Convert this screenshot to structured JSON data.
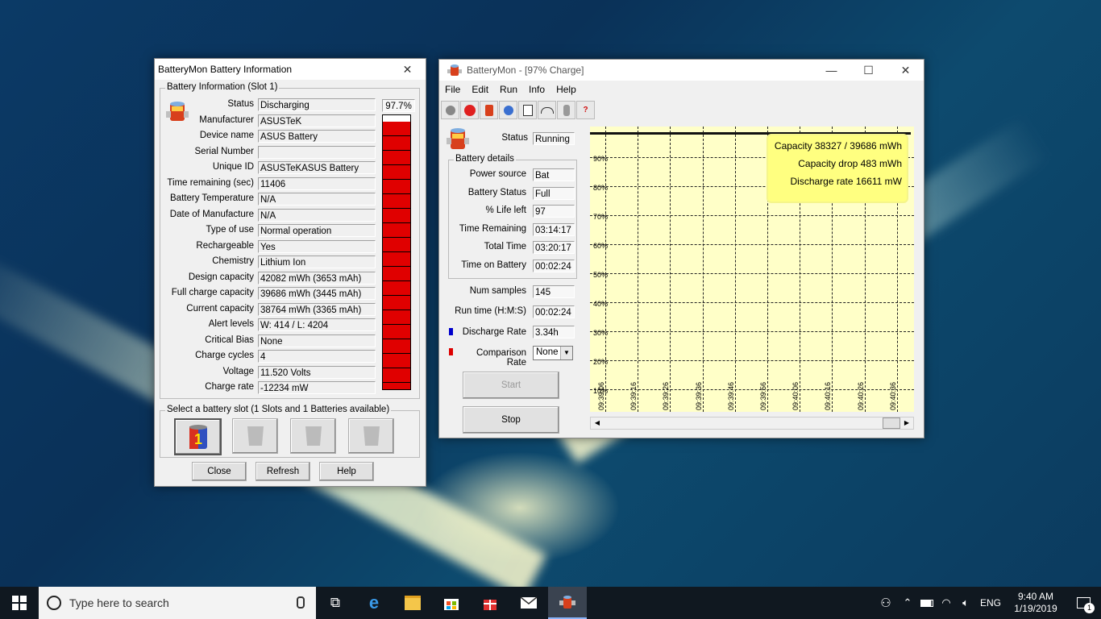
{
  "info_window": {
    "title": "BatteryMon Battery Information",
    "group_label": "Battery Information (Slot 1)",
    "percent": "97.7%",
    "fields": [
      {
        "label": "Status",
        "value": "Discharging"
      },
      {
        "label": "Manufacturer",
        "value": "ASUSTeK"
      },
      {
        "label": "Device name",
        "value": "ASUS Battery"
      },
      {
        "label": "Serial Number",
        "value": ""
      },
      {
        "label": "Unique ID",
        "value": "ASUSTeKASUS Battery"
      },
      {
        "label": "Time remaining (sec)",
        "value": "11406"
      },
      {
        "label": "Battery Temperature",
        "value": "N/A"
      },
      {
        "label": "Date of Manufacture",
        "value": "N/A"
      },
      {
        "label": "Type of use",
        "value": "Normal operation"
      },
      {
        "label": "Rechargeable",
        "value": "Yes"
      },
      {
        "label": "Chemistry",
        "value": "Lithium Ion"
      },
      {
        "label": "Design capacity",
        "value": "42082 mWh (3653 mAh)"
      },
      {
        "label": "Full charge capacity",
        "value": "39686 mWh (3445 mAh)"
      },
      {
        "label": "Current capacity",
        "value": "38764 mWh (3365 mAh)"
      },
      {
        "label": "Alert levels",
        "value": "W: 414 / L: 4204"
      },
      {
        "label": "Critical Bias",
        "value": "None"
      },
      {
        "label": "Charge cycles",
        "value": "4"
      },
      {
        "label": "Voltage",
        "value": "11.520 Volts"
      },
      {
        "label": "Charge rate",
        "value": "-12234 mW"
      }
    ],
    "slot_group_label": "Select a battery slot (1 Slots and 1 Batteries available)",
    "slot_one_label": "1",
    "buttons": {
      "close": "Close",
      "refresh": "Refresh",
      "help": "Help"
    }
  },
  "main_window": {
    "title": "BatteryMon - [97% Charge]",
    "menu": [
      "File",
      "Edit",
      "Run",
      "Info",
      "Help"
    ],
    "status_label": "Status",
    "status_value": "Running",
    "details_group": "Battery details",
    "details": [
      {
        "label": "Power source",
        "value": "Bat"
      },
      {
        "label": "Battery Status",
        "value": "Full"
      },
      {
        "label": "% Life left",
        "value": "97"
      },
      {
        "label": "Time Remaining",
        "value": "03:14:17"
      },
      {
        "label": "Total Time",
        "value": "03:20:17"
      },
      {
        "label": "Time on Battery",
        "value": "00:02:24"
      }
    ],
    "num_samples_label": "Num samples",
    "num_samples": "145",
    "run_time_label": "Run time (H:M:S)",
    "run_time": "00:02:24",
    "discharge_label": "Discharge Rate",
    "discharge_value": "3.34h",
    "comparison_label": "Comparison Rate",
    "comparison_value": "None",
    "start_label": "Start",
    "stop_label": "Stop",
    "colors": {
      "discharge": "#0000cc",
      "comparison": "#dd0000",
      "chart_bg": "#ffffc8"
    }
  },
  "chart_data": {
    "type": "line",
    "y_ticks": [
      "90%",
      "80%",
      "70%",
      "60%",
      "50%",
      "40%",
      "30%",
      "20%",
      "10%"
    ],
    "x_ticks": [
      "09:39:06",
      "09:39:16",
      "09:39:26",
      "09:39:36",
      "09:39:46",
      "09:39:56",
      "09:40:06",
      "09:40:16",
      "09:40:26",
      "09:40:36"
    ],
    "legend": [
      "Capacity 38327 / 39686 mWh",
      "Capacity drop 483 mWh",
      "Discharge rate 16611 mW"
    ],
    "legend_placement": "top-right",
    "grid": true
  },
  "taskbar": {
    "search_placeholder": "Type here to search",
    "lang": "ENG",
    "time": "9:40 AM",
    "date": "1/19/2019",
    "notif_count": "1"
  }
}
